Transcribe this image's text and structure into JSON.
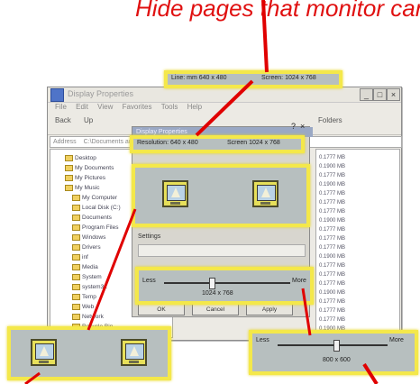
{
  "caption": {
    "text": "Hide pages that monitor can't display"
  },
  "status_callout": {
    "left": "Line: mm 640 x 480",
    "right": "Screen: 1024 x 768"
  },
  "window": {
    "title": "Display Properties",
    "menu": [
      "File",
      "Edit",
      "View",
      "Favorites",
      "Tools",
      "Help"
    ],
    "address_label": "Address",
    "address_value": "C:\\Documents and Settings",
    "toolbar": {
      "back_label": "Back",
      "up_label": "Up",
      "folders_label": "Folders"
    },
    "min_label": "_",
    "max_label": "□",
    "close_label": "×"
  },
  "tree": {
    "items": [
      "Desktop",
      "My Documents",
      "My Pictures",
      "My Music",
      "My Computer",
      "Local Disk (C:)",
      "Documents",
      "Program Files",
      "Windows",
      "Drivers",
      "inf",
      "Media",
      "System",
      "system32",
      "Temp",
      "Web",
      "Network",
      "Recycle Bin"
    ]
  },
  "list": {
    "items": [
      "0.1777 MB",
      "0.1900 MB",
      "0.1777 MB",
      "0.1900 MB",
      "0.1777 MB",
      "0.1777 MB",
      "0.1777 MB",
      "0.1900 MB",
      "0.1777 MB",
      "0.1777 MB",
      "0.1777 MB",
      "0.1900 MB",
      "0.1777 MB",
      "0.1777 MB",
      "0.1777 MB",
      "0.1900 MB",
      "0.1777 MB",
      "0.1777 MB",
      "0.1777 MB",
      "0.1900 MB"
    ]
  },
  "dialog": {
    "title": "Display Properties",
    "help_label": "?",
    "close_label": "×",
    "info_left": "Resolution: 640 x 480",
    "info_right": "Screen 1024 x 768",
    "settings_heading": "Settings",
    "screen_area_label": "Less",
    "screen_area_value": "More",
    "size_label": "1024 x 768",
    "buttons": [
      "OK",
      "Cancel",
      "Apply"
    ]
  },
  "zoom_bottom_left": {
    "monitor_count": 2
  },
  "zoom_bottom_right": {
    "left_label": "Less",
    "right_label": "More",
    "value": "800 x 600"
  },
  "colors": {
    "highlight": "#f4e84a",
    "arrow": "#e00000",
    "accent": "#4f74c8"
  }
}
